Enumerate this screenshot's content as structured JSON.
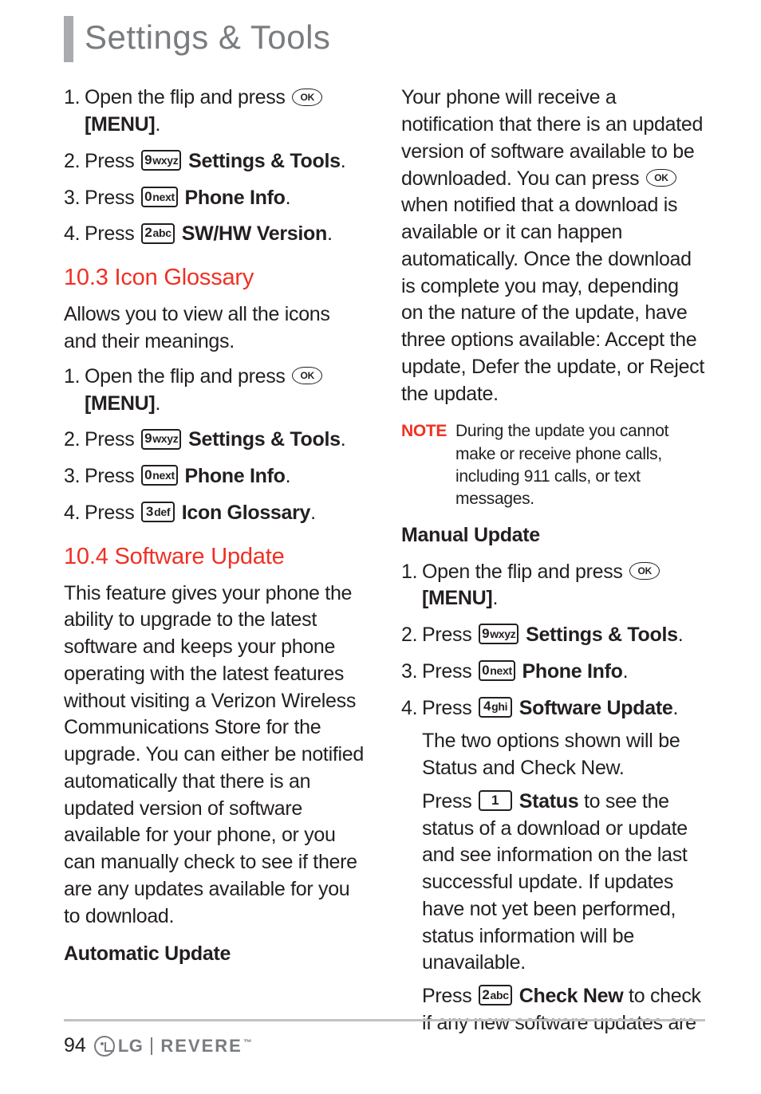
{
  "page_title": "Settings & Tools",
  "page_number": "94",
  "brand": {
    "lg": "LG",
    "model": "REVERE"
  },
  "keys": {
    "ok": "OK",
    "k9": {
      "big": "9",
      "small": "wxyz"
    },
    "k0": {
      "big": "0",
      "small": "next"
    },
    "k2": {
      "big": "2",
      "small": "abc"
    },
    "k3": {
      "big": "3",
      "small": "def"
    },
    "k4": {
      "big": "4",
      "small": "ghi"
    },
    "k1": {
      "big": "1",
      "small": ""
    }
  },
  "left": {
    "steps_a": [
      {
        "n": "1.",
        "pre": "Open the flip and press ",
        "key": "ok",
        "post": "",
        "bold_after": "[MENU]",
        "suffix": "."
      },
      {
        "n": "2.",
        "pre": "Press ",
        "key": "k9",
        "post": " ",
        "bold_after": "Settings & Tools",
        "suffix": "."
      },
      {
        "n": "3.",
        "pre": "Press ",
        "key": "k0",
        "post": " ",
        "bold_after": "Phone Info",
        "suffix": "."
      },
      {
        "n": "4.",
        "pre": "Press ",
        "key": "k2",
        "post": " ",
        "bold_after": "SW/HW Version",
        "suffix": "."
      }
    ],
    "sec_103_title": "10.3 Icon Glossary",
    "sec_103_body": "Allows you to view all the icons and their meanings.",
    "steps_b": [
      {
        "n": "1.",
        "pre": "Open the flip and press ",
        "key": "ok",
        "post": "",
        "bold_after": "[MENU]",
        "suffix": "."
      },
      {
        "n": "2.",
        "pre": "Press ",
        "key": "k9",
        "post": " ",
        "bold_after": "Settings & Tools",
        "suffix": "."
      },
      {
        "n": "3.",
        "pre": "Press ",
        "key": "k0",
        "post": " ",
        "bold_after": "Phone Info",
        "suffix": "."
      },
      {
        "n": "4.",
        "pre": "Press ",
        "key": "k3",
        "post": " ",
        "bold_after": "Icon Glossary",
        "suffix": "."
      }
    ],
    "sec_104_title": "10.4 Software Update",
    "sec_104_body": "This feature gives your phone the ability to upgrade to the latest software and keeps your phone operating with the latest features without visiting a Verizon Wireless Communications Store for the upgrade. You can either be notified automatically that there is an updated version of software available for your phone, or you can manually check to see if there are any updates available for you to download.",
    "auto_update_heading": "Automatic Update"
  },
  "right": {
    "auto_body_pre": "Your phone will receive a notification that there is an updated version of software available to be downloaded. You can press ",
    "auto_body_post": " when notified that a download is available or it can happen automatically. Once the download is complete you may, depending on the nature of the update, have three options available: Accept the update, Defer the update, or Reject the update.",
    "note_label": "NOTE",
    "note_body": "During the update you cannot make or receive phone calls, including 911 calls, or text messages.",
    "manual_heading": "Manual Update",
    "steps_c": [
      {
        "n": "1.",
        "pre": "Open the flip and press ",
        "key": "ok",
        "post": "",
        "bold_after": "[MENU]",
        "suffix": "."
      },
      {
        "n": "2.",
        "pre": "Press ",
        "key": "k9",
        "post": " ",
        "bold_after": "Settings & Tools",
        "suffix": "."
      },
      {
        "n": "3.",
        "pre": "Press ",
        "key": "k0",
        "post": " ",
        "bold_after": "Phone Info",
        "suffix": "."
      },
      {
        "n": "4.",
        "pre": "Press ",
        "key": "k4",
        "post": " ",
        "bold_after": "Software Update",
        "suffix": "."
      }
    ],
    "after_steps_1": "The two options shown will be Status and Check New.",
    "status_pre": "Press ",
    "status_bold": "Status",
    "status_post": " to see the status of a download or update and see information on the last successful update. If updates have not yet been performed, status information will be unavailable.",
    "checknew_pre": "Press ",
    "checknew_bold": "Check New",
    "checknew_post": " to check if any new software updates are"
  }
}
